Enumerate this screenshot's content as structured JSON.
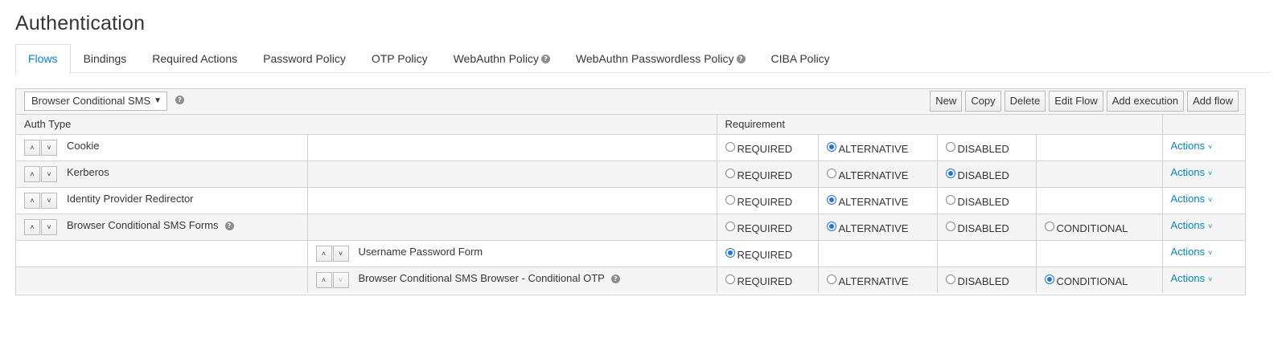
{
  "page": {
    "title": "Authentication"
  },
  "tabs": [
    {
      "label": "Flows",
      "active": true,
      "help": false
    },
    {
      "label": "Bindings",
      "help": false
    },
    {
      "label": "Required Actions",
      "help": false
    },
    {
      "label": "Password Policy",
      "help": false
    },
    {
      "label": "OTP Policy",
      "help": false
    },
    {
      "label": "WebAuthn Policy",
      "help": true
    },
    {
      "label": "WebAuthn Passwordless Policy",
      "help": true
    },
    {
      "label": "CIBA Policy",
      "help": false
    }
  ],
  "toolbar": {
    "flow_select": "Browser Conditional SMS",
    "buttons": [
      "New",
      "Copy",
      "Delete",
      "Edit Flow",
      "Add execution",
      "Add flow"
    ]
  },
  "table": {
    "headers": {
      "auth_type": "Auth Type",
      "requirement": "Requirement"
    },
    "rows": [
      {
        "name": "Cookie",
        "level": 0,
        "help": false,
        "options": [
          "REQUIRED",
          "ALTERNATIVE",
          "DISABLED"
        ],
        "selected": "ALTERNATIVE",
        "actions": "Actions"
      },
      {
        "name": "Kerberos",
        "level": 0,
        "help": false,
        "options": [
          "REQUIRED",
          "ALTERNATIVE",
          "DISABLED"
        ],
        "selected": "DISABLED",
        "actions": "Actions"
      },
      {
        "name": "Identity Provider Redirector",
        "level": 0,
        "help": false,
        "options": [
          "REQUIRED",
          "ALTERNATIVE",
          "DISABLED"
        ],
        "selected": "ALTERNATIVE",
        "actions": "Actions"
      },
      {
        "name": "Browser Conditional SMS Forms",
        "level": 0,
        "help": true,
        "options": [
          "REQUIRED",
          "ALTERNATIVE",
          "DISABLED",
          "CONDITIONAL"
        ],
        "selected": "ALTERNATIVE",
        "actions": "Actions"
      },
      {
        "name": "Username Password Form",
        "level": 1,
        "help": false,
        "options": [
          "REQUIRED"
        ],
        "selected": "REQUIRED",
        "actions": "Actions"
      },
      {
        "name": "Browser Conditional SMS Browser - Conditional OTP",
        "level": 1,
        "help": true,
        "down_disabled": true,
        "options": [
          "REQUIRED",
          "ALTERNATIVE",
          "DISABLED",
          "CONDITIONAL"
        ],
        "selected": "CONDITIONAL",
        "actions": "Actions"
      }
    ]
  },
  "colors": {
    "accent": "#0088ce",
    "radio_checked": "#1a73e8",
    "header_bg": "#f5f5f5"
  },
  "icons": {
    "help": "question-circle-icon",
    "up": "chevron-up-icon",
    "down": "chevron-down-icon"
  }
}
